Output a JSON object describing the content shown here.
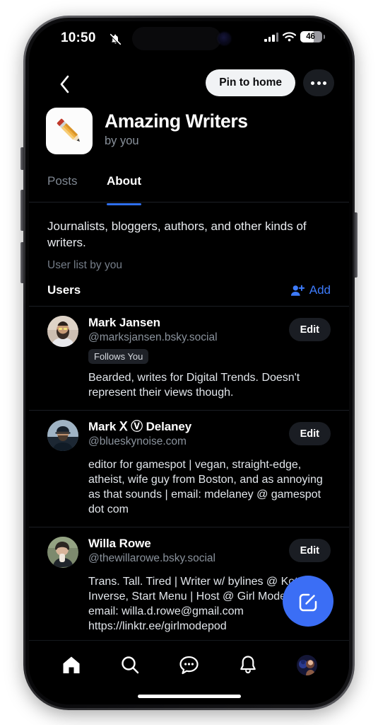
{
  "status_bar": {
    "time": "10:50",
    "mute_icon": "bell-slash-icon",
    "signal_icon": "cellular-signal-icon",
    "wifi_icon": "wifi-icon",
    "battery_level": "46"
  },
  "top_nav": {
    "back_icon": "chevron-left-icon",
    "pin_label": "Pin to home",
    "more_icon": "ellipsis-icon"
  },
  "header": {
    "avatar_emoji": "pencil-emoji",
    "title": "Amazing Writers",
    "byline": "by you"
  },
  "tabs": [
    {
      "label": "Posts",
      "active": false
    },
    {
      "label": "About",
      "active": true
    }
  ],
  "about": {
    "description": "Journalists, bloggers, authors, and other kinds of writers.",
    "list_by": "User list by you",
    "users_heading": "Users",
    "add_label": "Add",
    "add_icon": "person-plus-icon"
  },
  "users": [
    {
      "name": "Mark Jansen",
      "handle": "@marksjansen.bsky.social",
      "badge": "Follows You",
      "bio": "Bearded, writes for Digital Trends. Doesn't represent their views though.",
      "edit_label": "Edit"
    },
    {
      "name": "Mark Ⅹ Ⓥ Delaney",
      "handle": "@blueskynoise.com",
      "badge": "",
      "bio": "editor for gamespot | vegan, straight-edge, atheist, wife guy from Boston, and as annoying as that sounds | email: mdelaney @ gamespot dot com",
      "edit_label": "Edit"
    },
    {
      "name": "Willa Rowe",
      "handle": "@thewillarowe.bsky.social",
      "badge": "",
      "bio": "Trans. Tall. Tired | Writer w/ bylines @ Kotaku, Inverse, Start Menu | Host @ Girl Mode | her | email: willa.d.rowe@gmail.com https://linktr.ee/girlmodepod",
      "edit_label": "Edit"
    }
  ],
  "fab": {
    "icon": "compose-icon"
  },
  "bottom_nav": [
    {
      "icon": "home-icon",
      "active": true
    },
    {
      "icon": "search-icon",
      "active": false
    },
    {
      "icon": "chat-icon",
      "active": false
    },
    {
      "icon": "bell-icon",
      "active": false
    },
    {
      "icon": "profile-avatar",
      "active": false
    }
  ],
  "colors": {
    "accent_blue": "#3b6ef5",
    "link_blue": "#3d7bfb",
    "background": "#000000",
    "muted_text": "#8a929c"
  }
}
